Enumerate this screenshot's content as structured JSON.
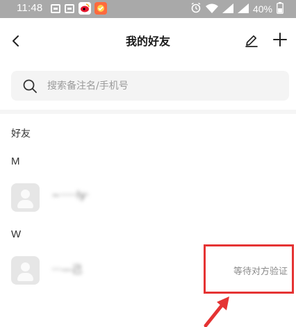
{
  "status_bar": {
    "time": "11:48",
    "battery": "40%"
  },
  "header": {
    "title": "我的好友"
  },
  "search": {
    "placeholder": "搜索备注名/手机号",
    "value": ""
  },
  "section": {
    "title": "好友"
  },
  "groups": [
    {
      "letter": "M",
      "friends": [
        {
          "name": "~·····ly·",
          "status": ""
        }
      ]
    },
    {
      "letter": "W",
      "friends": [
        {
          "name": "···—己",
          "status": "等待对方验证"
        }
      ]
    }
  ],
  "colors": {
    "accent_red": "#e53333",
    "status_bar": "#a9a9a9",
    "avatar_bg": "#e6e6e6"
  }
}
